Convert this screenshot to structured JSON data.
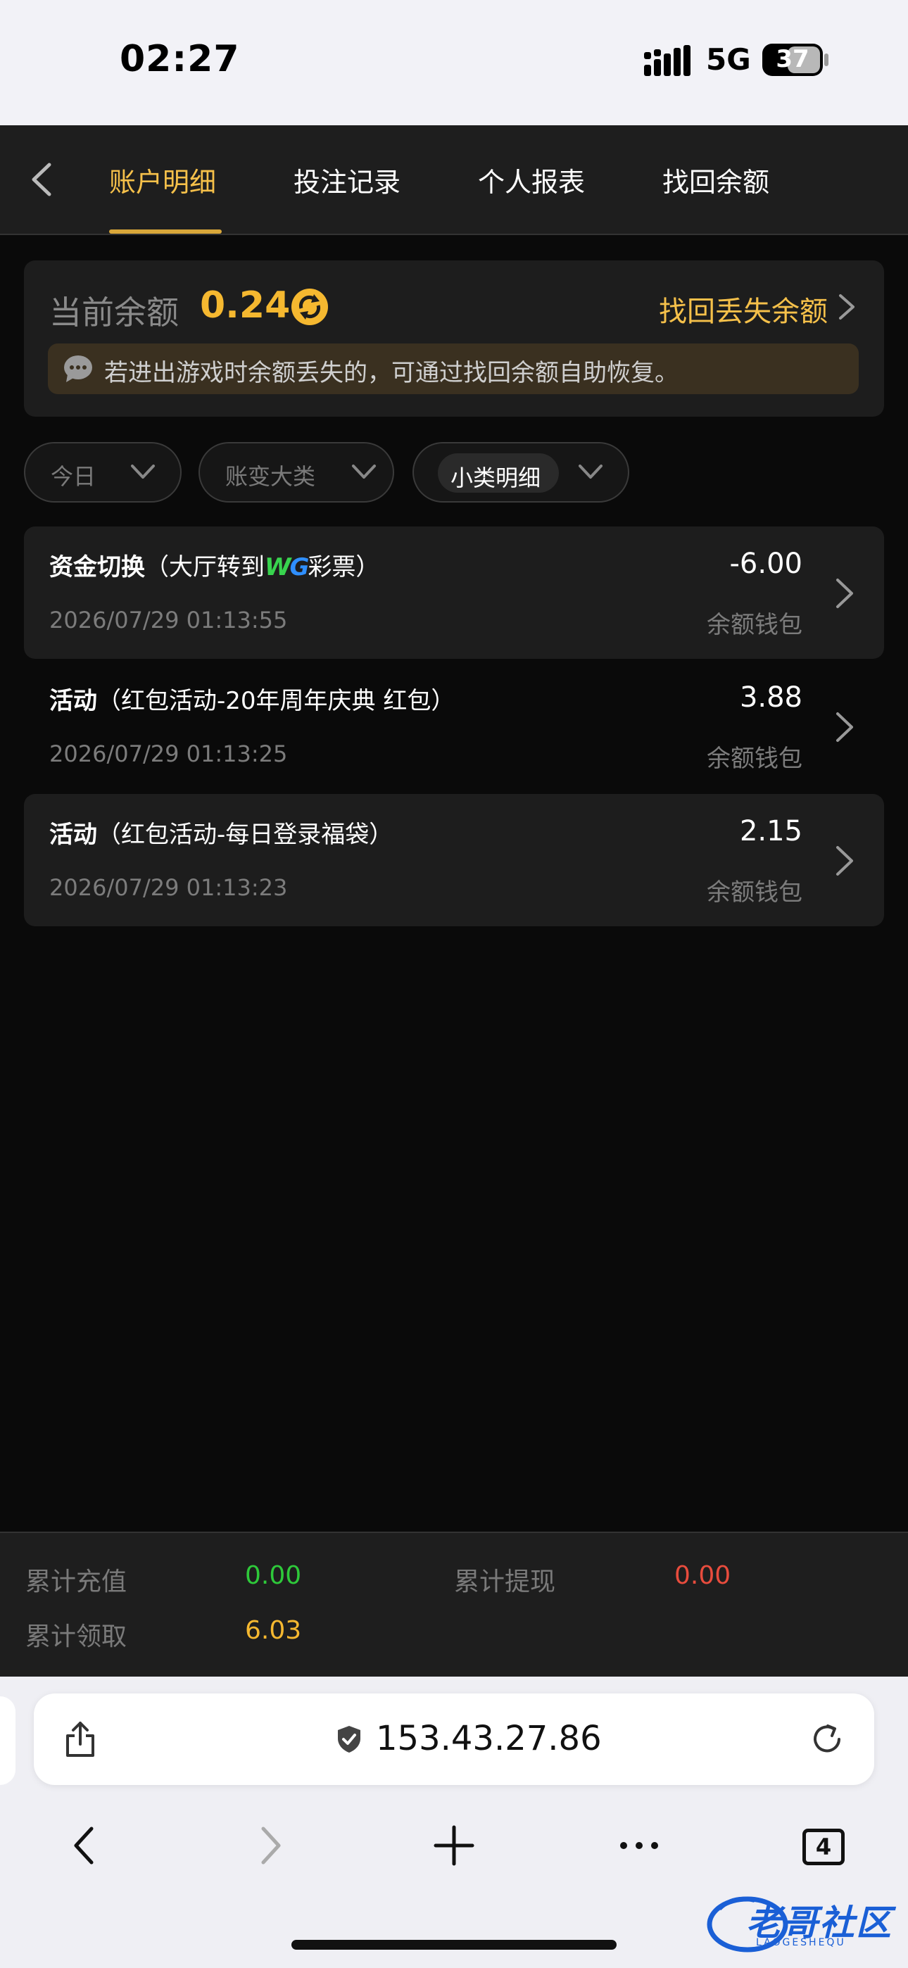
{
  "status_bar": {
    "time": "02:27",
    "network": "5G",
    "battery": "37"
  },
  "nav": {
    "tabs": [
      {
        "label": "账户明细",
        "active": true
      },
      {
        "label": "投注记录",
        "active": false
      },
      {
        "label": "个人报表",
        "active": false
      },
      {
        "label": "找回余额",
        "active": false
      }
    ]
  },
  "balance": {
    "label": "当前余额",
    "value": "0.24",
    "recover_link": "找回丢失余额",
    "tip": "若进出游戏时余额丢失的，可通过找回余额自助恢复。"
  },
  "filters": [
    {
      "label": "今日"
    },
    {
      "label": "账变大类"
    },
    {
      "label": "小类明细"
    }
  ],
  "records": [
    {
      "category": "资金切换",
      "detail_pre": "（大厅转到",
      "logo_w": "W",
      "logo_g": "G",
      "detail_post": "彩票）",
      "time": "2026/07/29 01:13:55",
      "amount": "-6.00",
      "wallet": "余额钱包"
    },
    {
      "category": "活动",
      "detail": "（红包活动-20年周年庆典 红包）",
      "time": "2026/07/29 01:13:25",
      "amount": "3.88",
      "wallet": "余额钱包"
    },
    {
      "category": "活动",
      "detail": "（红包活动-每日登录福袋）",
      "time": "2026/07/29 01:13:23",
      "amount": "2.15",
      "wallet": "余额钱包"
    }
  ],
  "summary": {
    "deposit_label": "累计充值",
    "deposit_value": "0.00",
    "withdraw_label": "累计提现",
    "withdraw_value": "0.00",
    "claim_label": "累计领取",
    "claim_value": "6.03"
  },
  "browser": {
    "url": "153.43.27.86",
    "tab_count": "4"
  },
  "watermark": {
    "text": "老哥社区",
    "sub": "LAOGESHEQU"
  },
  "colors": {
    "accent": "#f5c04a",
    "green": "#2ec93a",
    "red": "#e84c3d",
    "orange": "#f5b830"
  }
}
